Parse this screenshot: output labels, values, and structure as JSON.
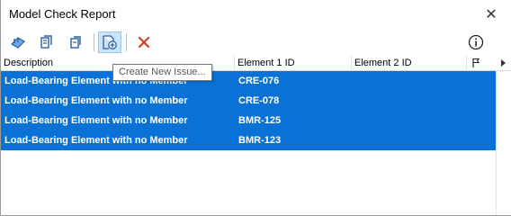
{
  "window": {
    "title": "Model Check Report"
  },
  "toolbar": {
    "buttons": [
      {
        "icon": "select-elements-icon"
      },
      {
        "icon": "open-report-icon"
      },
      {
        "icon": "open-element-icon"
      },
      {
        "icon": "create-issue-icon",
        "active": true
      },
      {
        "icon": "delete-icon"
      }
    ],
    "info_icon": "info-icon"
  },
  "tooltip": {
    "text": "Create New Issue..."
  },
  "table": {
    "columns": [
      "Description",
      "Element 1 ID",
      "Element 2 ID",
      ""
    ],
    "rows": [
      {
        "description": "Load-Bearing Element with no Member",
        "element1": "CRE-076",
        "element2": ""
      },
      {
        "description": "Load-Bearing Element with no Member",
        "element1": "CRE-078",
        "element2": ""
      },
      {
        "description": "Load-Bearing Element with no Member",
        "element1": "BMR-125",
        "element2": ""
      },
      {
        "description": "Load-Bearing Element with no Member",
        "element1": "BMR-123",
        "element2": ""
      }
    ]
  },
  "colors": {
    "selection": "#0a72d6",
    "delete": "#d83b2a",
    "icon_blue": "#2b5fa0"
  }
}
